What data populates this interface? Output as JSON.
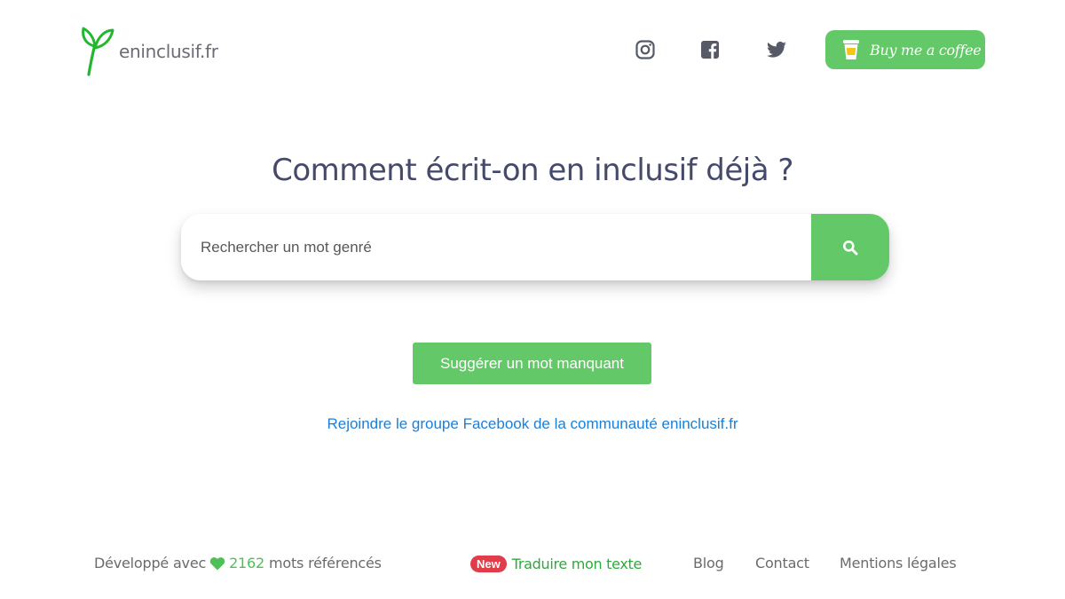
{
  "header": {
    "site_name": "eninclusif.fr",
    "social": [
      {
        "icon": "instagram-icon"
      },
      {
        "icon": "facebook-icon"
      },
      {
        "icon": "twitter-icon"
      }
    ],
    "coffee_button": {
      "label": "Buy me a coffee",
      "icon": "coffee-cup-icon"
    }
  },
  "main": {
    "headline": "Comment écrit-on en inclusif déjà ?",
    "search": {
      "placeholder": "Rechercher un mot genré",
      "value": ""
    },
    "suggest_button": "Suggérer un mot manquant",
    "facebook_group_link": "Rejoindre le groupe Facebook de la communauté eninclusif.fr"
  },
  "footer": {
    "developed_with": "Développé avec",
    "word_count": "2162",
    "words_label": "mots référencés",
    "new_badge": "New",
    "translate_link": "Traduire mon texte",
    "links": [
      "Blog",
      "Contact",
      "Mentions légales"
    ]
  },
  "colors": {
    "accent_green": "#63c867",
    "logo_green": "#22b82e",
    "headline": "#454a6b",
    "link_blue": "#1a7fd8",
    "badge_red": "#e03c4a",
    "icon_gray": "#555a66"
  }
}
